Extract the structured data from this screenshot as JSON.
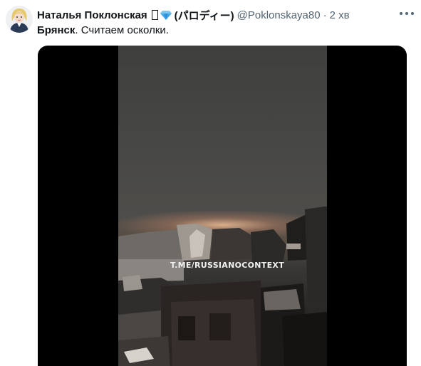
{
  "tweet": {
    "author_name": "Наталья Поклонская",
    "author_suffix": "(パロディー)",
    "handle": "@Poklonskaya80",
    "separator": "·",
    "time": "2 хв",
    "text_bold": "Брянск",
    "text_rest": ". Считаем осколки."
  },
  "icons": {
    "avatar": "avatar-portrait",
    "missing_emoji": "missing-glyph-box",
    "emoji": "blue-diamond-icon",
    "more": "more-options-icon"
  },
  "media": {
    "type": "video",
    "watermark": "T.ME/RUSSIANOCONTEXT"
  },
  "colors": {
    "text_primary": "#0f1419",
    "text_secondary": "#536471",
    "diamond": "#4aa8e8",
    "media_bg": "#000000"
  }
}
